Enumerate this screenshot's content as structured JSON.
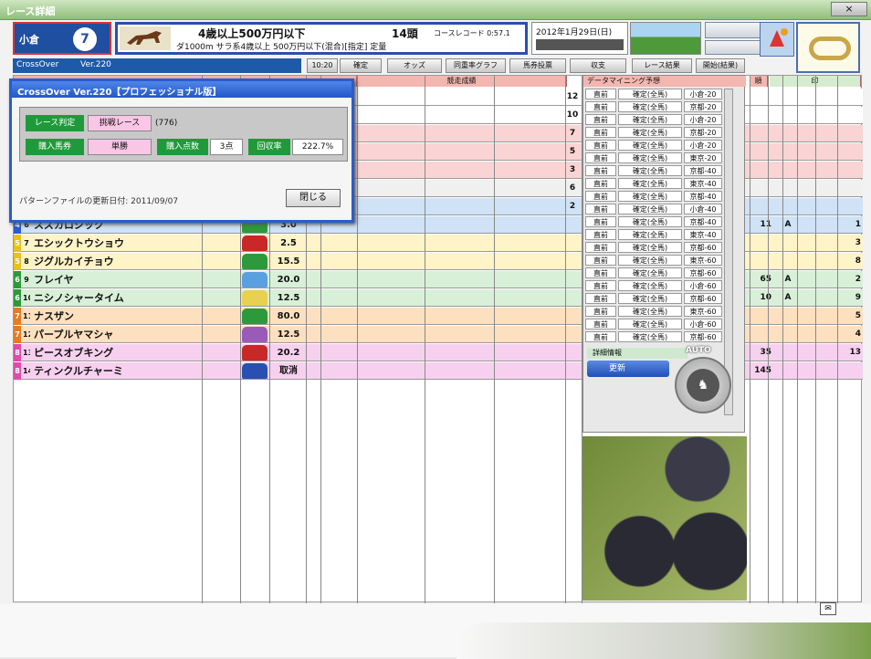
{
  "window": {
    "title": "レース詳細",
    "close_label": "×"
  },
  "race": {
    "venue": "小倉",
    "race_no": "7",
    "condition": "4歳以上500万円以下",
    "detail": "ダ1000m サラ系4歳以上 500万円以下(混合)[指定] 定量",
    "heads": "14頭",
    "record": "コースレコード 0:57.1",
    "date": "2012年1月29日(日)"
  },
  "toolbar": {
    "app_name": "CrossOver",
    "version": "Ver.220",
    "time": "10:20",
    "state": "確定",
    "buttons": [
      "オッズ",
      "同重率グラフ",
      "馬券投票",
      "収支",
      "レース結果",
      "開始(結果)"
    ]
  },
  "columns": {
    "past": "競走成績",
    "dm": "データマイニング予想",
    "rank": "順",
    "mark": "印"
  },
  "rows": [
    {
      "waku": "4",
      "num": "6",
      "name": "スズカロジック",
      "odds": "3.0",
      "rank": "",
      "rt2": "11",
      "mark": "A",
      "rt": "1",
      "bg": "#cfe2f6",
      "silk": "#2c9a3a"
    },
    {
      "waku": "5",
      "num": "7",
      "name": "エシックトウショウ",
      "odds": "2.5",
      "rank": "",
      "rt2": "",
      "mark": "",
      "rt": "3",
      "bg": "#fff3c8",
      "silk": "#c82828"
    },
    {
      "waku": "5",
      "num": "8",
      "name": "ジグルカイチョウ",
      "odds": "15.5",
      "rank": "",
      "rt2": "",
      "mark": "",
      "rt": "8",
      "bg": "#fff3c8",
      "silk": "#2c9a3a"
    },
    {
      "waku": "6",
      "num": "9",
      "name": "フレイヤ",
      "odds": "20.0",
      "rank": "",
      "rt2": "65",
      "mark": "A",
      "rt": "2",
      "bg": "#d8f0d8",
      "silk": "#5aa0e0"
    },
    {
      "waku": "6",
      "num": "10",
      "name": "ニシノシャータイム",
      "odds": "12.5",
      "rank": "",
      "rt2": "10",
      "mark": "A",
      "rt": "9",
      "bg": "#d8f0d8",
      "silk": "#e8d050"
    },
    {
      "waku": "7",
      "num": "11",
      "name": "ナスザン",
      "odds": "80.0",
      "rank": "",
      "rt2": "",
      "mark": "",
      "rt": "5",
      "bg": "#fde0c0",
      "silk": "#2c9a3a"
    },
    {
      "waku": "7",
      "num": "12",
      "name": "パープルヤマシャ",
      "odds": "12.5",
      "rank": "",
      "rt2": "",
      "mark": "",
      "rt": "4",
      "bg": "#fde0c0",
      "silk": "#9a5ab8"
    },
    {
      "waku": "8",
      "num": "13",
      "name": "ピースオブキング",
      "odds": "20.2",
      "rank": "",
      "rt2": "35",
      "mark": "",
      "rt": "13",
      "bg": "#f6d0ee",
      "silk": "#c82828"
    },
    {
      "waku": "8",
      "num": "14",
      "name": "ティンクルチャーミ",
      "odds": "取消",
      "rank": "",
      "rt2": "145",
      "mark": "",
      "rt": "",
      "bg": "#f6d0ee",
      "silk": "#2a4fb0"
    }
  ],
  "top_ranks": [
    "12",
    "10",
    "7",
    "5",
    "3",
    "6",
    "2"
  ],
  "dialog": {
    "title": "CrossOver Ver.220【プロフェッショナル版】",
    "race_judge_label": "レース判定",
    "race_judge_value": "挑戦レース",
    "race_judge_count": "(776)",
    "buy_type_label": "購入馬券",
    "buy_type_value": "単勝",
    "buy_points_label": "購入点数",
    "buy_points_value": "3点",
    "recovery_label": "回収率",
    "recovery_value": "222.7%",
    "pattern_date": "パターンファイルの更新日付: 2011/09/07",
    "close": "閉じる"
  },
  "datamining": {
    "title": "データマイニング予想",
    "rows": [
      {
        "a": "直前",
        "b": "確定(全馬)",
        "c": "小倉-20"
      },
      {
        "a": "直前",
        "b": "確定(全馬)",
        "c": "京都-20"
      },
      {
        "a": "直前",
        "b": "確定(全馬)",
        "c": "小倉-20"
      },
      {
        "a": "直前",
        "b": "確定(全馬)",
        "c": "京都-20"
      },
      {
        "a": "直前",
        "b": "確定(全馬)",
        "c": "小倉-20"
      },
      {
        "a": "直前",
        "b": "確定(全馬)",
        "c": "東京-20"
      },
      {
        "a": "直前",
        "b": "確定(全馬)",
        "c": "京都-40"
      },
      {
        "a": "直前",
        "b": "確定(全馬)",
        "c": "東京-40"
      },
      {
        "a": "直前",
        "b": "確定(全馬)",
        "c": "京都-40"
      },
      {
        "a": "直前",
        "b": "確定(全馬)",
        "c": "小倉-40"
      },
      {
        "a": "直前",
        "b": "確定(全馬)",
        "c": "京都-40"
      },
      {
        "a": "直前",
        "b": "確定(全馬)",
        "c": "東京-40"
      },
      {
        "a": "直前",
        "b": "確定(全馬)",
        "c": "京都-60"
      },
      {
        "a": "直前",
        "b": "確定(全馬)",
        "c": "東京-60"
      },
      {
        "a": "直前",
        "b": "確定(全馬)",
        "c": "京都-60"
      },
      {
        "a": "直前",
        "b": "確定(全馬)",
        "c": "小倉-60"
      },
      {
        "a": "直前",
        "b": "確定(全馬)",
        "c": "京都-60"
      },
      {
        "a": "直前",
        "b": "確定(全馬)",
        "c": "東京-60"
      },
      {
        "a": "直前",
        "b": "確定(全馬)",
        "c": "小倉-60"
      },
      {
        "a": "直前",
        "b": "確定(全馬)",
        "c": "京都-60"
      }
    ],
    "info": "詳細情報",
    "update": "更新",
    "auto": "AUTO"
  }
}
